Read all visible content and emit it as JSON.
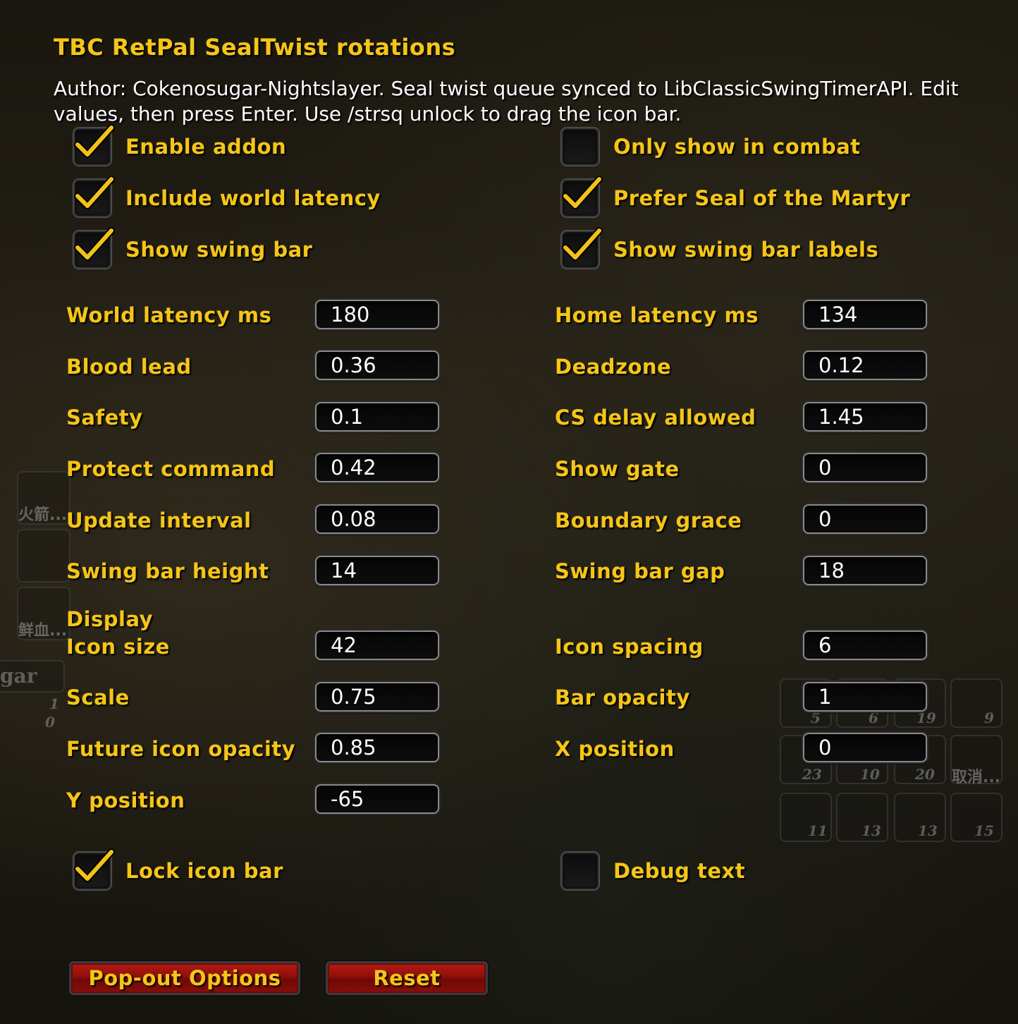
{
  "panel": {
    "title": "TBC RetPal SealTwist rotations",
    "description": "Author: Cokenosugar-Nightslayer. Seal twist queue synced to LibClassicSwingTimerAPI. Edit values, then press Enter. Use /strsq unlock to drag the icon bar."
  },
  "checkboxes_left": [
    {
      "label": "Enable addon",
      "checked": true
    },
    {
      "label": "Include world latency",
      "checked": true
    },
    {
      "label": "Show swing bar",
      "checked": true
    }
  ],
  "checkboxes_right": [
    {
      "label": "Only show in combat",
      "checked": false
    },
    {
      "label": "Prefer Seal of the Martyr",
      "checked": true
    },
    {
      "label": "Show swing bar labels",
      "checked": true
    }
  ],
  "fields_left": [
    {
      "label": "World latency ms",
      "value": "180"
    },
    {
      "label": "Blood lead",
      "value": "0.36"
    },
    {
      "label": "Safety",
      "value": "0.1"
    },
    {
      "label": "Protect command",
      "value": "0.42"
    },
    {
      "label": "Update interval",
      "value": "0.08"
    },
    {
      "label": "Swing bar height",
      "value": "14"
    }
  ],
  "fields_right": [
    {
      "label": "Home latency ms",
      "value": "134"
    },
    {
      "label": "Deadzone",
      "value": "0.12"
    },
    {
      "label": "CS delay allowed",
      "value": "1.45"
    },
    {
      "label": "Show gate",
      "value": "0"
    },
    {
      "label": "Boundary grace",
      "value": "0"
    },
    {
      "label": "Swing bar gap",
      "value": "18"
    }
  ],
  "display_section": {
    "heading": "Display",
    "fields_left": [
      {
        "label": "Icon size",
        "value": "42"
      },
      {
        "label": "Scale",
        "value": "0.75"
      },
      {
        "label": "Future icon opacity",
        "value": "0.85"
      },
      {
        "label": "Y position",
        "value": "-65"
      }
    ],
    "fields_right": [
      {
        "label": "Icon spacing",
        "value": "6"
      },
      {
        "label": "Bar opacity",
        "value": "1"
      },
      {
        "label": "X position",
        "value": "0"
      }
    ]
  },
  "bottom_checkboxes": [
    {
      "label": "Lock icon bar",
      "checked": true
    },
    {
      "label": "Debug text",
      "checked": false
    }
  ],
  "buttons": {
    "popout": "Pop-out Options",
    "reset": "Reset"
  },
  "background_text": {
    "cjk_1": "火箭...",
    "cjk_2": "鲜血...",
    "cjk_3": "取消...",
    "frag_gar": "gar",
    "slot_numbers": [
      "1",
      "0",
      "5",
      "6",
      "19",
      "9",
      "23",
      "10",
      "20",
      "11",
      "13",
      "13",
      "15"
    ]
  },
  "colors": {
    "label_gold": "#f5c518",
    "text_white": "#ffffff",
    "button_red": "#8e0f0a",
    "checkmark_gold": "#f2c21a"
  }
}
